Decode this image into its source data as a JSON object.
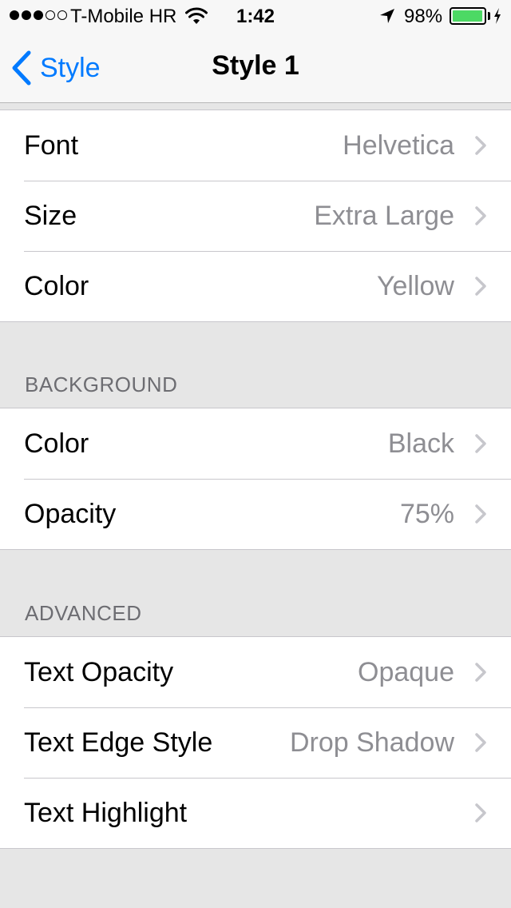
{
  "status_bar": {
    "signal_filled": 3,
    "signal_total": 5,
    "carrier": "T-Mobile HR",
    "time": "1:42",
    "battery_percent": "98%",
    "battery_level": 0.98,
    "battery_color": "#4cd964"
  },
  "nav": {
    "back_label": "Style",
    "title": "Style 1",
    "accent_color": "#007aff"
  },
  "groups": {
    "text": {
      "rows": [
        {
          "label": "Font",
          "value": "Helvetica"
        },
        {
          "label": "Size",
          "value": "Extra Large"
        },
        {
          "label": "Color",
          "value": "Yellow"
        }
      ]
    },
    "background": {
      "header": "BACKGROUND",
      "rows": [
        {
          "label": "Color",
          "value": "Black"
        },
        {
          "label": "Opacity",
          "value": "75%"
        }
      ]
    },
    "advanced": {
      "header": "ADVANCED",
      "rows": [
        {
          "label": "Text Opacity",
          "value": "Opaque"
        },
        {
          "label": "Text Edge Style",
          "value": "Drop Shadow"
        },
        {
          "label": "Text Highlight",
          "value": ""
        }
      ]
    }
  },
  "icons": {
    "back": "chevron-left-icon",
    "disclosure": "chevron-right-icon",
    "wifi": "wifi-icon",
    "location": "location-arrow-icon",
    "battery": "battery-icon",
    "charging": "bolt-icon"
  }
}
